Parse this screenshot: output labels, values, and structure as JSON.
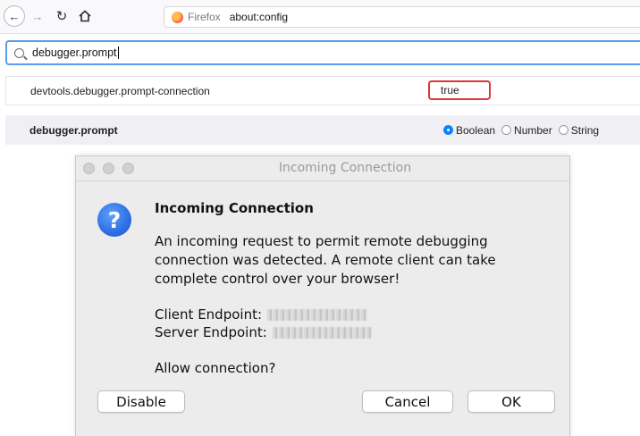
{
  "browser": {
    "brand": "Firefox",
    "url": "about:config",
    "icons": [
      "back-arrow-icon",
      "forward-arrow-icon",
      "reload-icon",
      "home-icon",
      "firefox-logo"
    ]
  },
  "config": {
    "search_value": "debugger.prompt",
    "existing_pref": {
      "name": "devtools.debugger.prompt-connection",
      "value": "true"
    },
    "new_pref": {
      "name": "debugger.prompt",
      "types": [
        "Boolean",
        "Number",
        "String"
      ],
      "selected_type": "Boolean"
    },
    "highlight_color": "#e0353a"
  },
  "dialog": {
    "window_title": "Incoming Connection",
    "heading": "Incoming Connection",
    "message": "An incoming request to permit remote debugging connection was detected. A remote client can take complete control over your browser!",
    "client_endpoint_label": "Client Endpoint:",
    "server_endpoint_label": "Server Endpoint:",
    "question": "Allow connection?",
    "buttons": {
      "disable": "Disable",
      "cancel": "Cancel",
      "ok": "OK"
    },
    "icon": "question-icon",
    "icon_color": "#2d6fe3"
  }
}
